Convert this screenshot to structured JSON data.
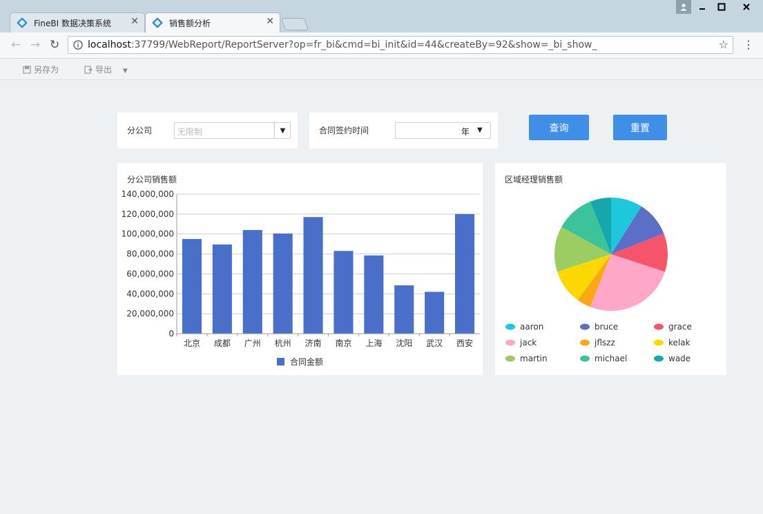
{
  "browser": {
    "tabs": [
      {
        "label": "FineBI 数据决策系统",
        "close": "✕"
      },
      {
        "label": "销售额分析",
        "close": "✕"
      }
    ],
    "url_host": "localhost",
    "url_rest": ":37799/WebReport/ReportServer?op=fr_bi&cmd=bi_init&id=44&createBy=92&show=_bi_show_",
    "window_controls": [
      "minimize",
      "maximize",
      "close"
    ]
  },
  "actions": {
    "save_as": "另存为",
    "export": "导出"
  },
  "filters": {
    "branch_label": "分公司",
    "branch_placeholder": "无限制",
    "date_label": "合同签约时间",
    "date_value": "年",
    "query_button": "查询",
    "reset_button": "重置"
  },
  "colors": {
    "accent": "#3f8fe8",
    "bar": "#4a6fca"
  },
  "chart_data": [
    {
      "type": "bar",
      "title": "分公司销售额",
      "categories": [
        "北京",
        "成都",
        "广州",
        "杭州",
        "济南",
        "南京",
        "上海",
        "沈阳",
        "武汉",
        "西安"
      ],
      "series": [
        {
          "name": "合同金额",
          "values": [
            95000000,
            89500000,
            104000000,
            100500000,
            117000000,
            83000000,
            78500000,
            48500000,
            42000000,
            120000000
          ],
          "color": "#4a6fca"
        }
      ],
      "ylim": [
        0,
        140000000
      ],
      "yticks": [
        "0",
        "20,000,000",
        "40,000,000",
        "60,000,000",
        "80,000,000",
        "100,000,000",
        "120,000,000",
        "140,000,000"
      ],
      "legend": "bottom",
      "grid": true
    },
    {
      "type": "pie",
      "title": "区域经理销售额",
      "slices": [
        {
          "label": "aaron",
          "value": 9.0,
          "color": "#1ec8dc"
        },
        {
          "label": "bruce",
          "value": 10.0,
          "color": "#5b6ec8"
        },
        {
          "label": "grace",
          "value": 11.0,
          "color": "#f5546a"
        },
        {
          "label": "jack",
          "value": 26.0,
          "color": "#ffa7c8"
        },
        {
          "label": "jflszz",
          "value": 4.0,
          "color": "#f7a812"
        },
        {
          "label": "kelak",
          "value": 10.0,
          "color": "#fbd800"
        },
        {
          "label": "martin",
          "value": 13.0,
          "color": "#9ccd62"
        },
        {
          "label": "michael",
          "value": 11.0,
          "color": "#3cc39a"
        },
        {
          "label": "wade",
          "value": 6.0,
          "color": "#16a7ad"
        }
      ],
      "legend": "bottom"
    }
  ]
}
